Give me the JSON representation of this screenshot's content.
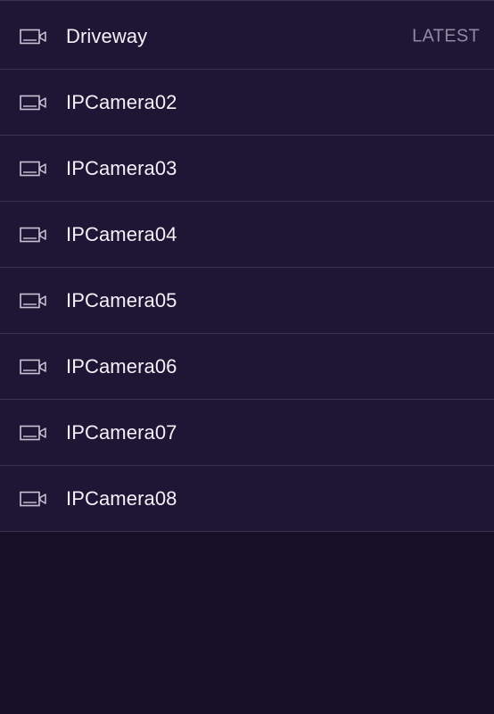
{
  "cameras": [
    {
      "name": "Driveway",
      "badge": "LATEST",
      "icon": "video-camera-icon"
    },
    {
      "name": "IPCamera02",
      "icon": "video-camera-icon"
    },
    {
      "name": "IPCamera03",
      "icon": "video-camera-icon"
    },
    {
      "name": "IPCamera04",
      "icon": "video-camera-icon"
    },
    {
      "name": "IPCamera05",
      "icon": "video-camera-icon"
    },
    {
      "name": "IPCamera06",
      "icon": "video-camera-icon"
    },
    {
      "name": "IPCamera07",
      "icon": "video-camera-icon"
    },
    {
      "name": "IPCamera08",
      "icon": "video-camera-icon"
    }
  ],
  "colors": {
    "background": "#170f26",
    "list_background": "#1f1535",
    "divider": "#3a3050",
    "text": "#f3f1f7",
    "badge_text": "#908aa0",
    "icon_stroke": "#c9c4d4"
  }
}
